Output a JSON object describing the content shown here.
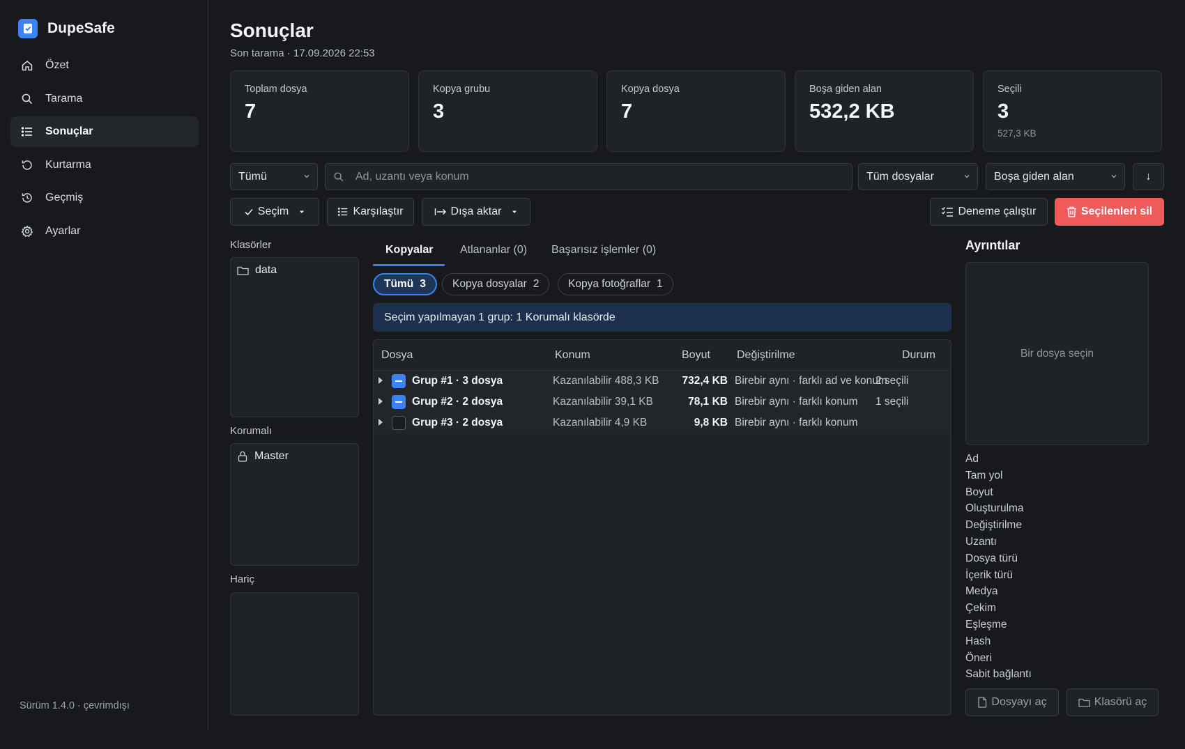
{
  "brand": {
    "name": "DupeSafe"
  },
  "sidebar": {
    "items": [
      {
        "label": "Özet",
        "icon": "home-icon"
      },
      {
        "label": "Tarama",
        "icon": "search-icon"
      },
      {
        "label": "Sonuçlar",
        "icon": "list-icon",
        "active": true
      },
      {
        "label": "Kurtarma",
        "icon": "restore-icon"
      },
      {
        "label": "Geçmiş",
        "icon": "history-icon"
      },
      {
        "label": "Ayarlar",
        "icon": "gear-icon"
      }
    ],
    "version": "Sürüm 1.4.0 · çevrimdışı"
  },
  "header": {
    "title": "Sonuçlar",
    "subtitle": "Son tarama · 17.09.2026 22:53"
  },
  "stats": [
    {
      "label": "Toplam dosya",
      "value": "7"
    },
    {
      "label": "Kopya grubu",
      "value": "3"
    },
    {
      "label": "Kopya dosya",
      "value": "7"
    },
    {
      "label": "Boşa giden alan",
      "value": "532,2 KB"
    },
    {
      "label": "Seçili",
      "value": "3",
      "sub": "527,3 KB"
    }
  ],
  "filters": {
    "scope": "Tümü",
    "search_placeholder": "Ad, uzantı veya konum",
    "file_filter": "Tüm dosyalar",
    "sort": "Boşa giden alan",
    "sort_direction": "↓"
  },
  "toolbar": {
    "selection": "Seçim",
    "compare": "Karşılaştır",
    "export": "Dışa aktar",
    "dry_run": "Deneme çalıştır",
    "delete_selected": "Seçilenleri sil"
  },
  "folders": {
    "label": "Klasörler",
    "items": [
      "data"
    ],
    "protected_label": "Korumalı",
    "protected_items": [
      "Master"
    ],
    "excluded_label": "Hariç"
  },
  "tabs": [
    {
      "label": "Kopyalar",
      "active": true
    },
    {
      "label": "Atlananlar (0)"
    },
    {
      "label": "Başarısız işlemler (0)"
    }
  ],
  "chips": [
    {
      "label": "Tümü",
      "count": "3",
      "active": true
    },
    {
      "label": "Kopya dosyalar",
      "count": "2"
    },
    {
      "label": "Kopya fotoğraflar",
      "count": "1"
    }
  ],
  "notice": "Seçim yapılmayan 1 grup: 1 Korumalı klasörde",
  "table": {
    "columns": [
      "Dosya",
      "Konum",
      "Boyut",
      "Değiştirilme",
      "Durum"
    ],
    "rows": [
      {
        "name": "Grup #1  ·  3 dosya",
        "location": "Kazanılabilir 488,3 KB",
        "size": "732,4 KB",
        "modified": "Birebir aynı · farklı ad ve konum",
        "status": "2 seçili",
        "check": "partial"
      },
      {
        "name": "Grup #2  ·  2 dosya",
        "location": "Kazanılabilir 39,1 KB",
        "size": "78,1 KB",
        "modified": "Birebir aynı · farklı konum",
        "status": "1 seçili",
        "check": "partial"
      },
      {
        "name": "Grup #3  ·  2 dosya",
        "location": "Kazanılabilir 4,9 KB",
        "size": "9,8 KB",
        "modified": "Birebir aynı · farklı konum",
        "status": "",
        "check": "empty"
      }
    ]
  },
  "details": {
    "title": "Ayrıntılar",
    "placeholder": "Bir dosya seçin",
    "fields": [
      "Ad",
      "Tam yol",
      "Boyut",
      "Oluşturulma",
      "Değiştirilme",
      "Uzantı",
      "Dosya türü",
      "İçerik türü",
      "Medya",
      "Çekim",
      "Eşleşme",
      "Hash",
      "Öneri",
      "Sabit bağlantı"
    ],
    "open_file": "Dosyayı aç",
    "open_folder": "Klasörü aç"
  },
  "colors": {
    "accent": "#3b82f6",
    "danger": "#ef5b5b",
    "background": "#17191d",
    "panel": "#1f2227"
  }
}
